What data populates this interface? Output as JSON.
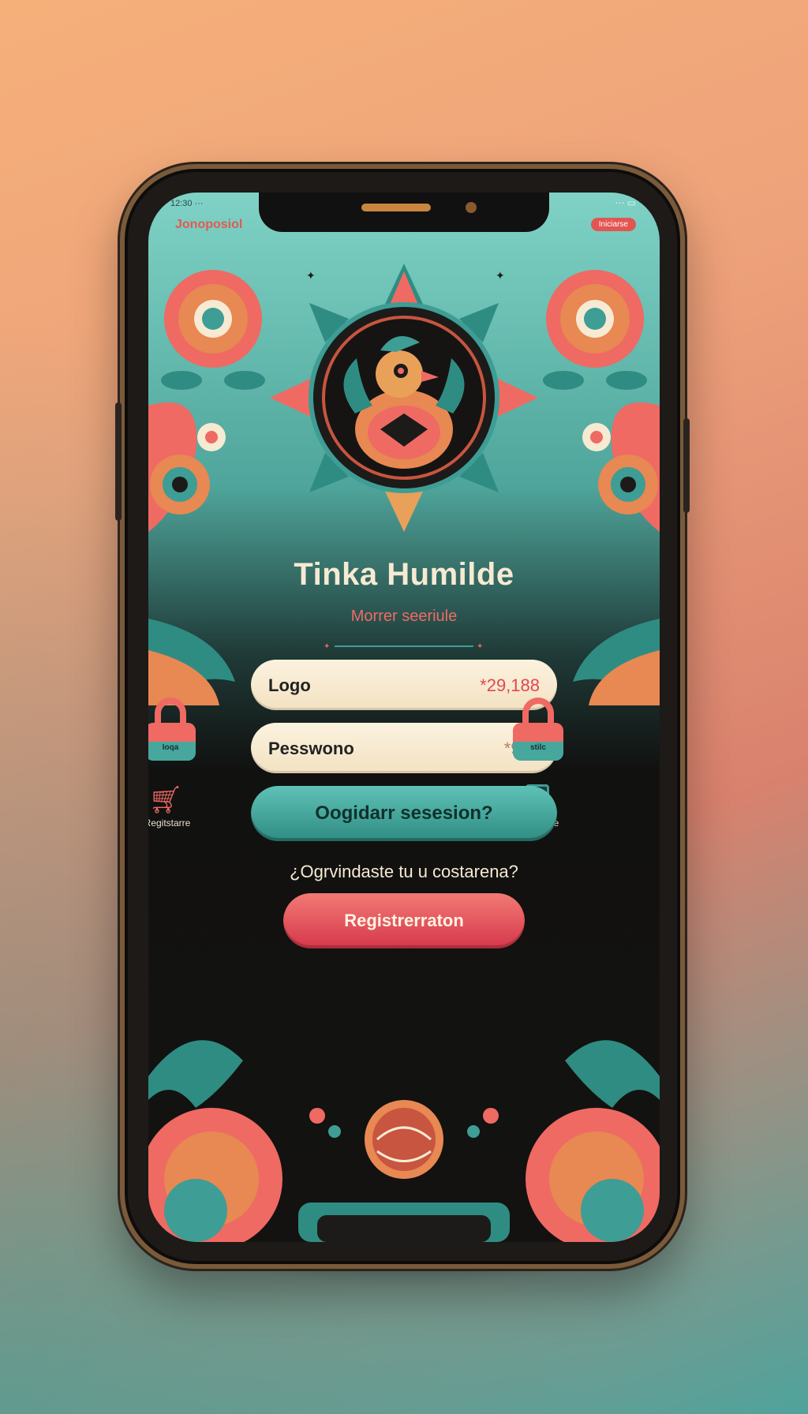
{
  "status_bar": {
    "left_text": "12:30 ···",
    "right_text": "⋯ ▭"
  },
  "header": {
    "brand_label": "Jonoposiol",
    "pill_label": "Iniciarse"
  },
  "app": {
    "title": "Tinka Humilde",
    "subtitle": "Morrer seeriule"
  },
  "form": {
    "username": {
      "label": "Logo",
      "value": "*29,188"
    },
    "password": {
      "label": "Pesswono",
      "value": "*910"
    },
    "login_button": "Oogidarr sesesion?",
    "forgot_link": "¿Ogrvindaste tu u costarena?",
    "register_button": "Registrerraton"
  },
  "side_icons": {
    "left_lock_text": "Ioqa",
    "right_lock_text": "stilc",
    "cart_caption": "Regitstarre",
    "phone_caption": "Ngenonre"
  },
  "colors": {
    "accent_coral": "#ef6a63",
    "accent_teal": "#3e9d95",
    "cream": "#f6ead3",
    "screen_dark": "#111110"
  }
}
